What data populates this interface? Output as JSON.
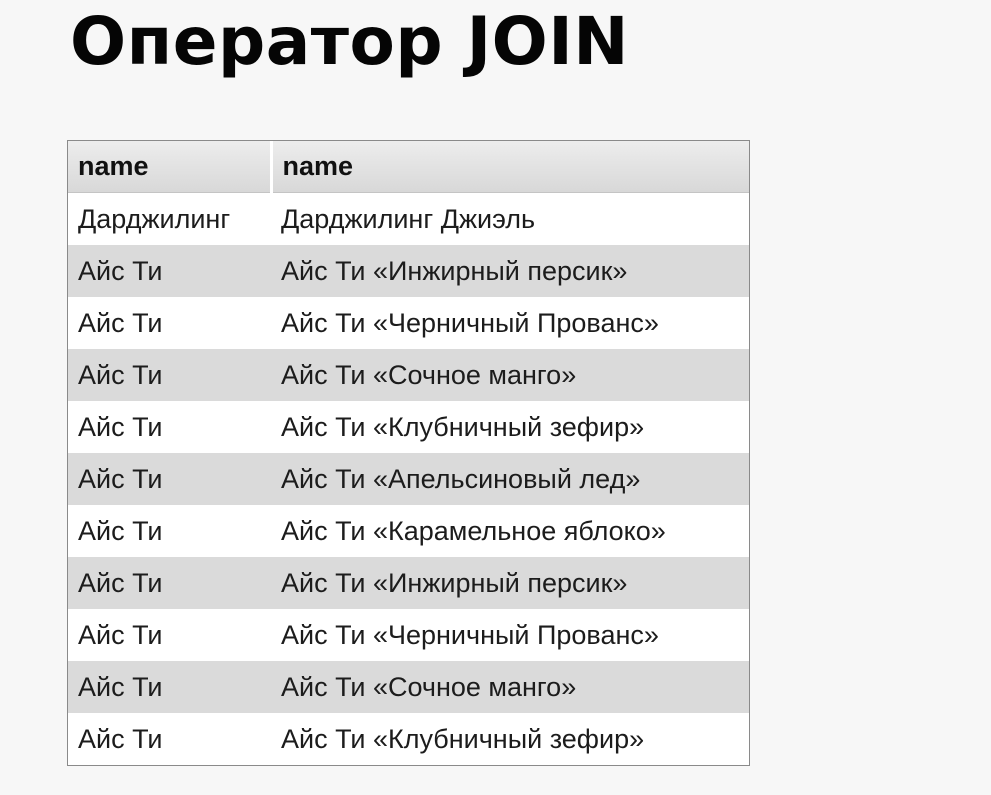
{
  "slide": {
    "title": "Оператор JOIN"
  },
  "table": {
    "columns": [
      "name",
      "name"
    ],
    "rows": [
      [
        "Дарджилинг",
        "Дарджилинг Джиэль"
      ],
      [
        "Айс Ти",
        "Айс Ти «Инжирный персик»"
      ],
      [
        "Айс Ти",
        "Айс Ти «Черничный Прованс»"
      ],
      [
        "Айс Ти",
        "Айс Ти «Сочное манго»"
      ],
      [
        "Айс Ти",
        "Айс Ти «Клубничный зефир»"
      ],
      [
        "Айс Ти",
        "Айс Ти «Апельсиновый лед»"
      ],
      [
        "Айс Ти",
        "Айс Ти «Карамельное яблоко»"
      ],
      [
        "Айс Ти",
        "Айс Ти «Инжирный персик»"
      ],
      [
        "Айс Ти",
        "Айс Ти «Черничный Прованс»"
      ],
      [
        "Айс Ти",
        "Айс Ти «Сочное манго»"
      ],
      [
        "Айс Ти",
        "Айс Ти «Клубничный зефир»"
      ]
    ]
  }
}
